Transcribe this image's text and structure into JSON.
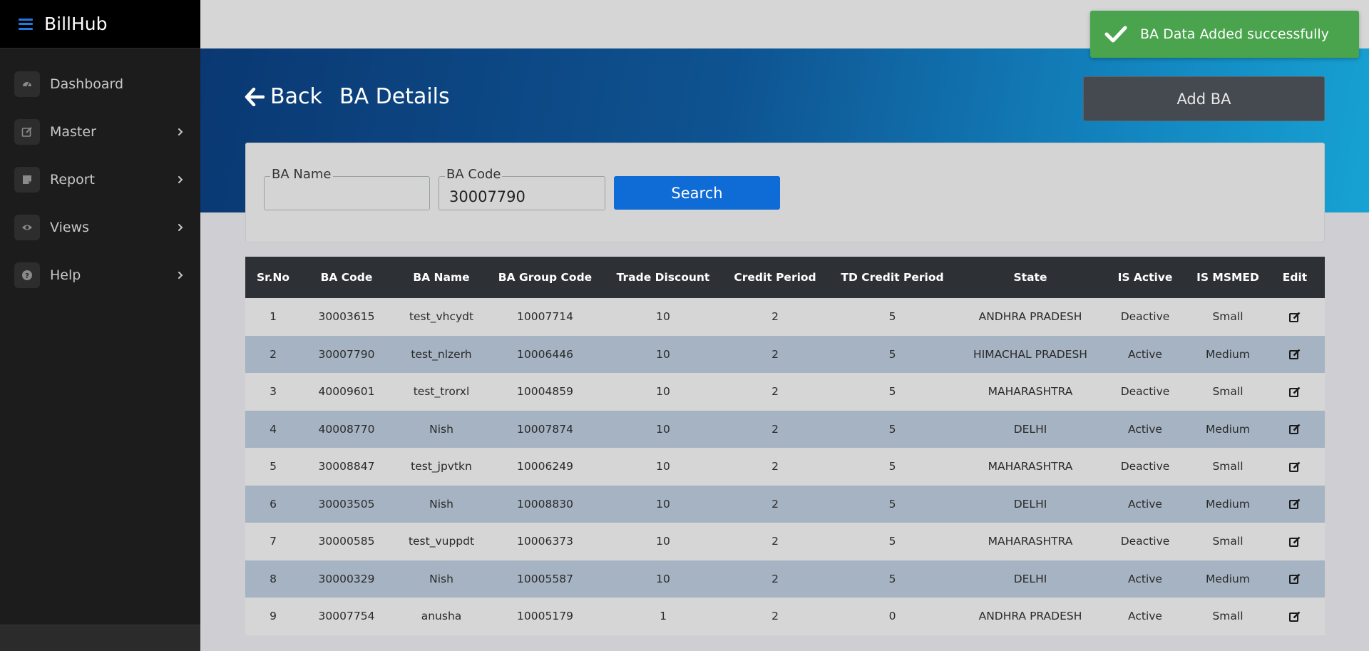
{
  "app": {
    "name": "BillHub"
  },
  "sidebar": {
    "items": [
      {
        "label": "Dashboard",
        "icon": "dashboard-icon",
        "has_submenu": false
      },
      {
        "label": "Master",
        "icon": "edit-icon",
        "has_submenu": true
      },
      {
        "label": "Report",
        "icon": "report-icon",
        "has_submenu": true
      },
      {
        "label": "Views",
        "icon": "eye-icon",
        "has_submenu": true
      },
      {
        "label": "Help",
        "icon": "help-icon",
        "has_submenu": true
      }
    ]
  },
  "header": {
    "back_label": "Back",
    "title": "BA Details",
    "add_button": "Add BA"
  },
  "toast": {
    "message": "BA Data Added successfully",
    "color": "#4aa34d"
  },
  "search": {
    "ba_name_label": "BA Name",
    "ba_name_value": "",
    "ba_code_label": "BA Code",
    "ba_code_value": "30007790",
    "button_label": "Search"
  },
  "table": {
    "columns": [
      "Sr.No",
      "BA Code",
      "BA Name",
      "BA Group Code",
      "Trade Discount",
      "Credit Period",
      "TD Credit Period",
      "State",
      "IS Active",
      "IS MSMED",
      "Edit"
    ],
    "rows": [
      [
        "1",
        "30003615",
        "test_vhcydt",
        "10007714",
        "10",
        "2",
        "5",
        "ANDHRA PRADESH",
        "Deactive",
        "Small"
      ],
      [
        "2",
        "30007790",
        "test_nlzerh",
        "10006446",
        "10",
        "2",
        "5",
        "HIMACHAL PRADESH",
        "Active",
        "Medium"
      ],
      [
        "3",
        "40009601",
        "test_trorxl",
        "10004859",
        "10",
        "2",
        "5",
        "MAHARASHTRA",
        "Deactive",
        "Small"
      ],
      [
        "4",
        "40008770",
        "Nish",
        "10007874",
        "10",
        "2",
        "5",
        "DELHI",
        "Active",
        "Medium"
      ],
      [
        "5",
        "30008847",
        "test_jpvtkn",
        "10006249",
        "10",
        "2",
        "5",
        "MAHARASHTRA",
        "Deactive",
        "Small"
      ],
      [
        "6",
        "30003505",
        "Nish",
        "10008830",
        "10",
        "2",
        "5",
        "DELHI",
        "Active",
        "Medium"
      ],
      [
        "7",
        "30000585",
        "test_vuppdt",
        "10006373",
        "10",
        "2",
        "5",
        "MAHARASHTRA",
        "Deactive",
        "Small"
      ],
      [
        "8",
        "30000329",
        "Nish",
        "10005587",
        "10",
        "2",
        "5",
        "DELHI",
        "Active",
        "Medium"
      ],
      [
        "9",
        "30007754",
        "anusha",
        "10005179",
        "1",
        "2",
        "0",
        "ANDHRA PRADESH",
        "Active",
        "Small"
      ]
    ]
  },
  "colors": {
    "sidebar_bg": "#1c1c1c",
    "accent_blue": "#0f6bd6",
    "header_dark": "#2d3135",
    "row_alt": "#a5b3c3"
  }
}
